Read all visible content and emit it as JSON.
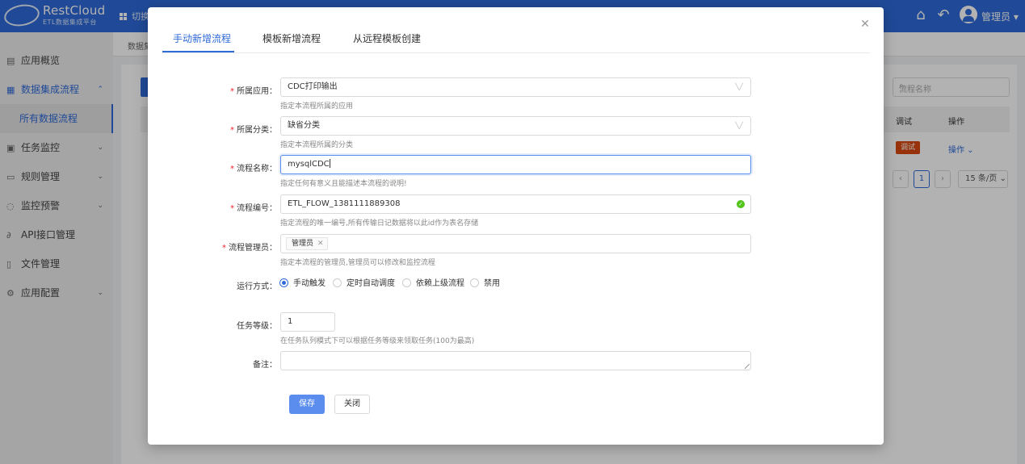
{
  "header": {
    "logo_name": "RestCloud",
    "logo_sub": "ETL数据集成平台",
    "switch_label": "切换",
    "user": "管理员"
  },
  "sidebar": {
    "items": [
      {
        "label": "应用概览",
        "icon": "dashboard-icon"
      },
      {
        "label": "数据集成流程",
        "icon": "grid-icon"
      },
      {
        "label": "所有数据流程"
      },
      {
        "label": "任务监控",
        "icon": "monitor-icon"
      },
      {
        "label": "规则管理",
        "icon": "rules-icon"
      },
      {
        "label": "监控预警",
        "icon": "bell-icon"
      },
      {
        "label": "API接口管理",
        "icon": "link-icon"
      },
      {
        "label": "文件管理",
        "icon": "file-icon"
      },
      {
        "label": "应用配置",
        "icon": "gear-icon"
      }
    ]
  },
  "background": {
    "breadcrumb": "数据集",
    "search_placeholder": "流程名称",
    "columns": [
      "调试",
      "操作"
    ],
    "row_debug": "调试",
    "row_op": "操作",
    "current_page": "1",
    "page_size": "15 条/页"
  },
  "modal": {
    "tabs": [
      "手动新增流程",
      "模板新增流程",
      "从远程模板创建"
    ],
    "form": {
      "app": {
        "label": "所属应用：",
        "value": "CDC打印输出",
        "help": "指定本流程所属的应用"
      },
      "category": {
        "label": "所属分类：",
        "value": "缺省分类",
        "help": "指定本流程所属的分类"
      },
      "flow_name": {
        "label": "流程名称：",
        "value": "mysqlCDC",
        "help": "指定任何有意义且能描述本流程的说明!"
      },
      "flow_id": {
        "label": "流程编号：",
        "value": "ETL_FLOW_1381111889308",
        "help": "指定流程的唯一编号,所有传输日记数据将以此id作为表名存储"
      },
      "manager": {
        "label": "流程管理员：",
        "tag": "管理员",
        "help": "指定本流程的管理员,管理员可以修改和监控流程"
      },
      "run_mode": {
        "label": "运行方式：",
        "options": [
          "手动触发",
          "定时自动调度",
          "依赖上级流程",
          "禁用"
        ],
        "selected": "手动触发"
      },
      "level": {
        "label": "任务等级：",
        "value": "1",
        "help": "在任务队列模式下可以根据任务等级来领取任务(100为最高)"
      },
      "remark": {
        "label": "备注：",
        "value": ""
      }
    },
    "save_label": "保存",
    "close_label": "关闭"
  },
  "colors": {
    "primary": "#2f6ad8",
    "required": "#f5222d",
    "success": "#52c41a",
    "danger": "#d9480f"
  }
}
